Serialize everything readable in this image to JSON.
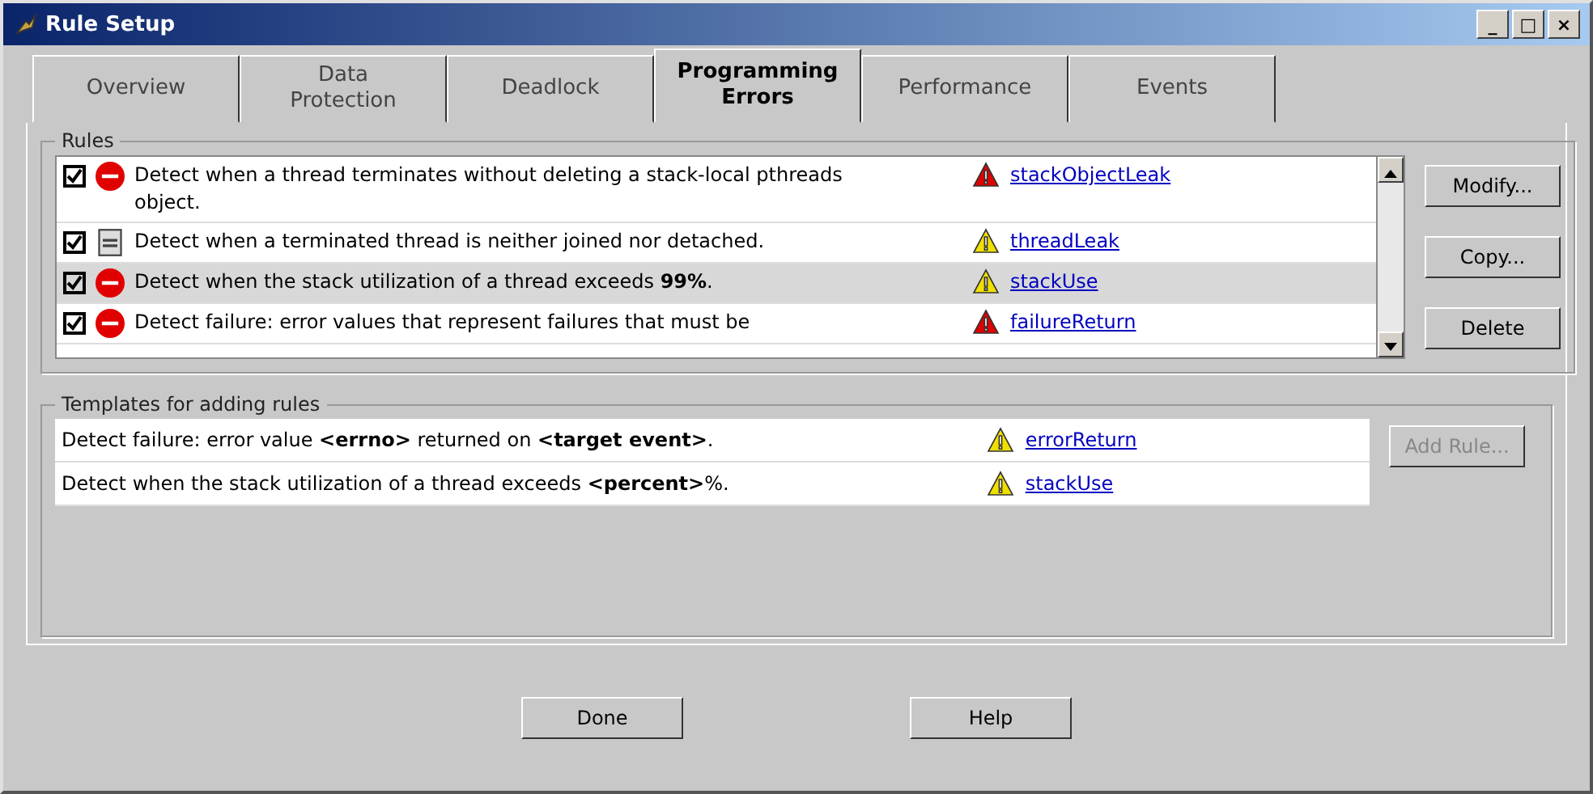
{
  "window": {
    "title": "Rule Setup",
    "controls": [
      "_",
      "□",
      "×"
    ]
  },
  "tabs": [
    {
      "label": "Overview",
      "selected": false
    },
    {
      "label": "Data\nProtection",
      "selected": false
    },
    {
      "label": "Deadlock",
      "selected": false
    },
    {
      "label": "Programming\nErrors",
      "selected": true
    },
    {
      "label": "Performance",
      "selected": false
    },
    {
      "label": "Events",
      "selected": false
    }
  ],
  "rules": {
    "title": "Rules",
    "items": [
      {
        "checked": true,
        "kind": "stop",
        "text": "Detect when a thread terminates without deleting a stack-local pthreads object.",
        "color": "#e00000",
        "link": "stackObjectLeak",
        "selected": false
      },
      {
        "checked": true,
        "kind": "note",
        "text": "Detect when a terminated thread is neither joined nor detached.",
        "color": "#f0e000",
        "link": "threadLeak",
        "selected": false
      },
      {
        "checked": true,
        "kind": "stop",
        "text": "Detect when the stack utilization of a thread exceeds **99%**.",
        "color": "#f0e000",
        "link": "stackUse",
        "selected": true
      },
      {
        "checked": true,
        "kind": "stop",
        "text": "Detect failure: error values that represent failures that must be",
        "color": "#e00000",
        "link": "failureReturn",
        "selected": false
      }
    ],
    "buttons": [
      {
        "label": "Modify...",
        "disabled": false
      },
      {
        "label": "Copy...",
        "disabled": false
      },
      {
        "label": "Delete",
        "disabled": false
      }
    ]
  },
  "templates": {
    "title": "Templates for adding rules",
    "items": [
      {
        "text": "Detect failure: error value **<errno>** returned on **<target event>**.",
        "color": "#f0e000",
        "link": "errorReturn"
      },
      {
        "text": "Detect when the stack utilization of a thread exceeds **<percent>**%.",
        "color": "#f0e000",
        "link": "stackUse"
      }
    ],
    "button": {
      "label": "Add Rule...",
      "disabled": true
    }
  },
  "footer": [
    "Done",
    "Help"
  ]
}
